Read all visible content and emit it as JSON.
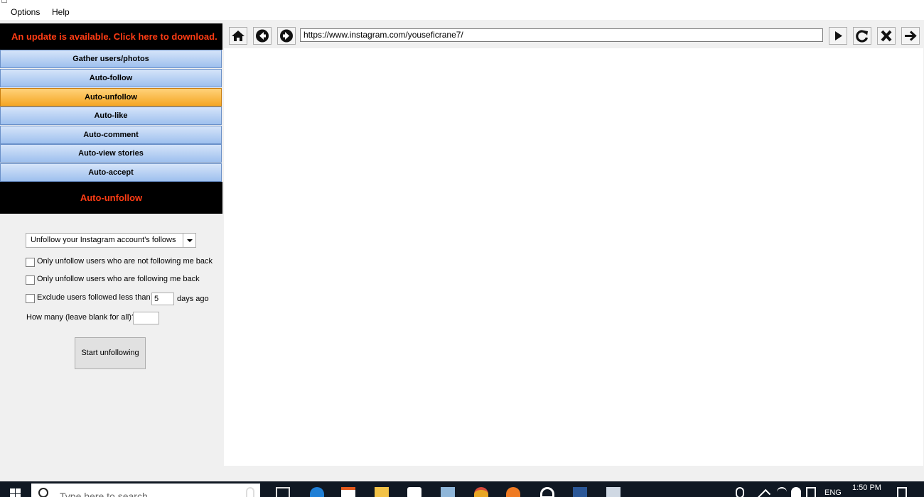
{
  "menu": {
    "options": "Options",
    "help": "Help"
  },
  "update_banner": "An update is available. Click here to download.",
  "nav": [
    {
      "label": "Gather users/photos",
      "active": false
    },
    {
      "label": "Auto-follow",
      "active": false
    },
    {
      "label": "Auto-unfollow",
      "active": true
    },
    {
      "label": "Auto-like",
      "active": false
    },
    {
      "label": "Auto-comment",
      "active": false
    },
    {
      "label": "Auto-view stories",
      "active": false
    },
    {
      "label": "Auto-accept",
      "active": false
    }
  ],
  "section_title": "Auto-unfollow",
  "form": {
    "mode_select": "Unfollow your Instagram account's follows",
    "opt_not_following_back": "Only unfollow users who are not following me back",
    "opt_following_back": "Only unfollow users who are following me back",
    "opt_exclude_prefix": "Exclude users followed less than",
    "exclude_days_value": "5",
    "opt_exclude_suffix": "days ago",
    "how_many_label": "How many (leave blank for all)?",
    "how_many_value": "",
    "start_button": "Start unfollowing"
  },
  "browser": {
    "url": "https://www.instagram.com/youseficrane7/"
  },
  "taskbar": {
    "search_placeholder": "Type here to search",
    "language": "ENG",
    "time": "1:50 PM"
  },
  "icons": {
    "home": "home-icon",
    "back": "back-icon",
    "forward": "forward-icon",
    "go": "play-icon",
    "refresh": "refresh-icon",
    "stop": "close-icon",
    "navigate": "arrow-right-icon"
  }
}
